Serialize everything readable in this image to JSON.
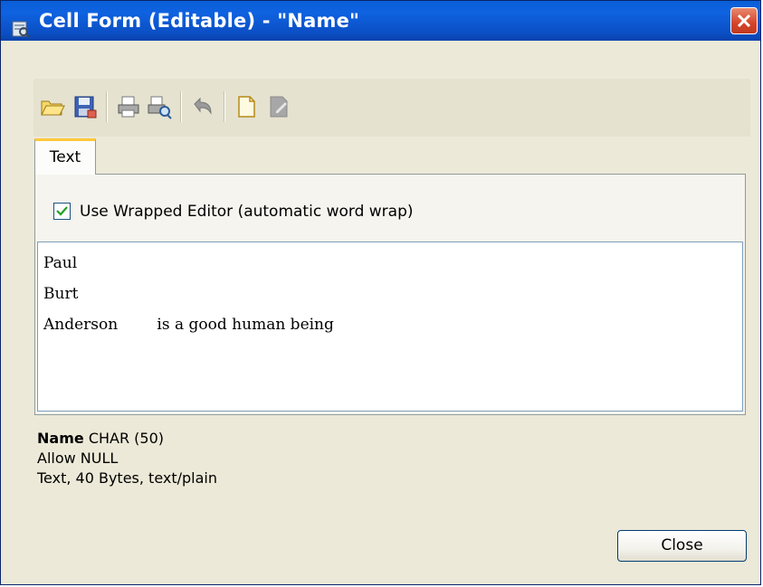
{
  "window": {
    "title": "Cell Form (Editable) - \"Name\"",
    "title_color": "#0a5fd8",
    "close_icon": "close-x-icon"
  },
  "toolbar": {
    "buttons": [
      {
        "name": "open-folder-icon",
        "enabled": true
      },
      {
        "name": "save-icon",
        "enabled": true
      },
      {
        "name": "print-icon",
        "enabled": true
      },
      {
        "name": "print-preview-icon",
        "enabled": true
      },
      {
        "name": "undo-icon",
        "enabled": false
      },
      {
        "name": "new-document-icon",
        "enabled": true
      },
      {
        "name": "edit-document-icon",
        "enabled": false
      }
    ]
  },
  "tabs": [
    {
      "label": "Text",
      "active": true
    }
  ],
  "editor_options": {
    "wrap_label": "Use Wrapped Editor (automatic word wrap)",
    "wrap_checked": true
  },
  "editor": {
    "lines": [
      "Paul",
      "Burt",
      "Anderson        is a good human being"
    ]
  },
  "column_info": {
    "name": "Name",
    "type": "CHAR (50)",
    "nullability": "Allow NULL",
    "content_summary": "Text, 40 Bytes, text/plain"
  },
  "footer": {
    "close_label": "Close"
  }
}
